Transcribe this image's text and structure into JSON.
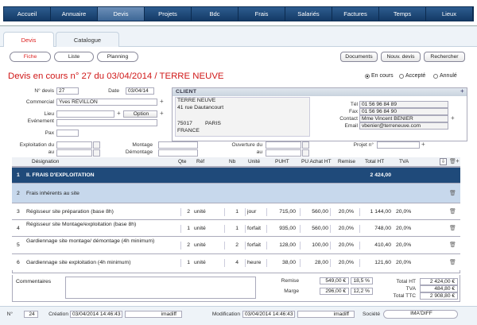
{
  "nav": [
    "Accueil",
    "Annuaire",
    "Devis",
    "Projets",
    "Bdc",
    "Frais",
    "Salariés",
    "Factures",
    "Temps",
    "Lieux"
  ],
  "nav_active": "Devis",
  "tabs": {
    "devis": "Devis",
    "catalogue": "Catalogue"
  },
  "pills": {
    "fiche": "Fiche",
    "liste": "Liste",
    "planning": "Planning"
  },
  "right_buttons": {
    "documents": "Documents",
    "nouv": "Nouv. devis",
    "rechercher": "Rechercher"
  },
  "title": "Devis en cours n° 27 du 03/04/2014 / TERRE NEUVE",
  "status": {
    "en_cours": "En cours",
    "accepte": "Accepté",
    "annule": "Annulé",
    "selected": "En cours"
  },
  "form": {
    "ndevis_label": "N° devis",
    "ndevis": "27",
    "date_label": "Date",
    "date": "03/04/14",
    "commercial_label": "Commercial",
    "commercial": "Yves REVILLON",
    "lieu_label": "Lieu",
    "evenement_label": "Evénement",
    "option_label": "Option",
    "pax_label": "Pax",
    "exploitation_label": "Exploitation du",
    "au_label": "au",
    "montage_label": "Montage",
    "demontage_label": "Démontage",
    "ouverture_label": "Ouverture du",
    "ouverture_au": "au",
    "projet_label": "Projet n°"
  },
  "client": {
    "header": "CLIENT",
    "name": "TERRE NEUVE",
    "address": "41 rue Dautancourt",
    "cp": "75017",
    "city": "PARIS",
    "country": "FRANCE",
    "tel_label": "Tél",
    "tel": "01 56 96 84 89",
    "fax_label": "Fax",
    "fax": "01 56 96 84 90",
    "contact_label": "Contact",
    "contact": "Mme Vincent BENIER",
    "email_label": "Email",
    "email": "vbenier@terreneuve.com"
  },
  "table": {
    "headers": {
      "designation": "Désignation",
      "qte": "Qte",
      "ref": "Réf",
      "nb": "Nb",
      "unite": "Unité",
      "puht": "PUHT",
      "puachat": "PU Achat HT",
      "remise": "Remise",
      "totalht": "Total HT",
      "tva": "TVA"
    },
    "rows": [
      {
        "n": "1",
        "designation": "II. FRAIS D'EXPLOITATION",
        "qte": "",
        "ref": "",
        "nb": "",
        "unite": "",
        "puht": "",
        "puachat": "",
        "remise": "",
        "total": "2 424,00",
        "tva": "",
        "kind": "section"
      },
      {
        "n": "2",
        "designation": "Frais inhérents au site",
        "qte": "",
        "ref": "",
        "nb": "",
        "unite": "",
        "puht": "",
        "puachat": "",
        "remise": "",
        "total": "",
        "tva": "",
        "kind": "sub"
      },
      {
        "n": "3",
        "designation": "Régisseur site préparation (base 8h)",
        "qte": "2",
        "ref": "unité",
        "nb": "1",
        "unite": "jour",
        "puht": "715,00",
        "puachat": "560,00",
        "remise": "20,0%",
        "total": "1 144,00",
        "tva": "20,0%",
        "kind": "item"
      },
      {
        "n": "4",
        "designation": "Régisseur site Montage/exploitation (base 8h)",
        "qte": "1",
        "ref": "unité",
        "nb": "1",
        "unite": "forfait",
        "puht": "935,00",
        "puachat": "560,00",
        "remise": "20,0%",
        "total": "748,00",
        "tva": "20,0%",
        "kind": "item"
      },
      {
        "n": "5",
        "designation": "Gardiennage site montage/ démontage (4h minimum)",
        "qte": "2",
        "ref": "unité",
        "nb": "2",
        "unite": "forfait",
        "puht": "128,00",
        "puachat": "100,00",
        "remise": "20,0%",
        "total": "410,40",
        "tva": "20,0%",
        "kind": "item"
      },
      {
        "n": "6",
        "designation": "Gardiennage site exploitation (4h minimum)",
        "qte": "1",
        "ref": "unité",
        "nb": "4",
        "unite": "heure",
        "puht": "38,00",
        "puachat": "28,00",
        "remise": "20,0%",
        "total": "121,60",
        "tva": "20,0%",
        "kind": "item"
      }
    ]
  },
  "totals": {
    "commentaires_label": "Commentaires",
    "remise_label": "Remise",
    "remise": "549,00 €",
    "remise_pct": "18,5 %",
    "marge_label": "Marge",
    "marge": "296,00 €",
    "marge_pct": "12,2 %",
    "totalht_label": "Total HT",
    "totalht": "2 424,00 €",
    "tva_label": "TVA",
    "tva": "484,80 €",
    "totalttc_label": "Total TTC",
    "totalttc": "2 908,80 €"
  },
  "footer": {
    "n_label": "N°",
    "n": "24",
    "creation_label": "Création",
    "creation_date": "03/04/2014 14:46:43",
    "creation_user": "imadiff",
    "modif_label": "Modification",
    "modif_date": "03/04/2014 14:46:43",
    "modif_user": "imadiff",
    "societe_label": "Société",
    "societe": "IMA'DIFF"
  },
  "colors": {
    "nav": "#1e4b7c",
    "accent": "#d01818",
    "section_row": "#1f4a7a",
    "sub_row": "#c7d8ec"
  }
}
